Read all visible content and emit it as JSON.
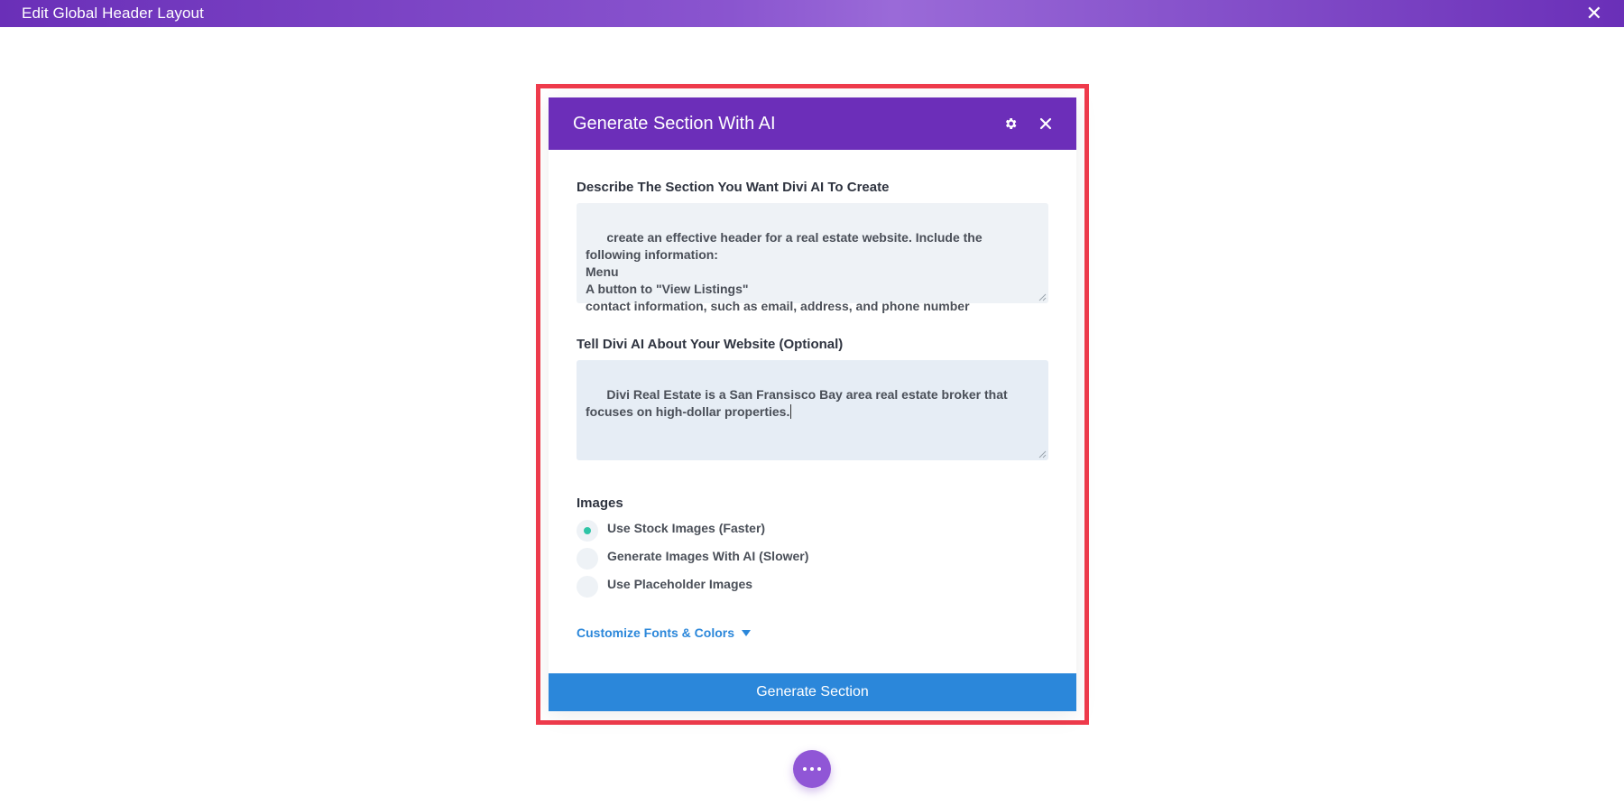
{
  "topbar": {
    "title": "Edit Global Header Layout",
    "close_icon": "close-icon"
  },
  "modal": {
    "title": "Generate Section With AI",
    "settings_icon": "gear-icon",
    "close_icon": "close-icon",
    "describe_label": "Describe The Section You Want Divi AI To Create",
    "describe_value": "create an effective header for a real estate website. Include the\nfollowing information:\nMenu\nA button to \"View Listings\"\ncontact information, such as email, address, and phone number",
    "website_label": "Tell Divi AI About Your Website (Optional)",
    "website_value": "Divi Real Estate is a San Fransisco Bay area real estate broker that\nfocuses on high-dollar properties.",
    "images_label": "Images",
    "image_options": [
      {
        "label": "Use Stock Images (Faster)",
        "selected": true
      },
      {
        "label": "Generate Images With AI (Slower)",
        "selected": false
      },
      {
        "label": "Use Placeholder Images",
        "selected": false
      }
    ],
    "customize_label": "Customize Fonts & Colors",
    "generate_label": "Generate Section"
  },
  "colors": {
    "topbar": "#6a2fb8",
    "modal_header": "#6c2eb9",
    "primary_button": "#2b87da",
    "highlight_border": "#ef3b4c",
    "radio_selected": "#2ec4a6",
    "fab": "#9056d6"
  }
}
